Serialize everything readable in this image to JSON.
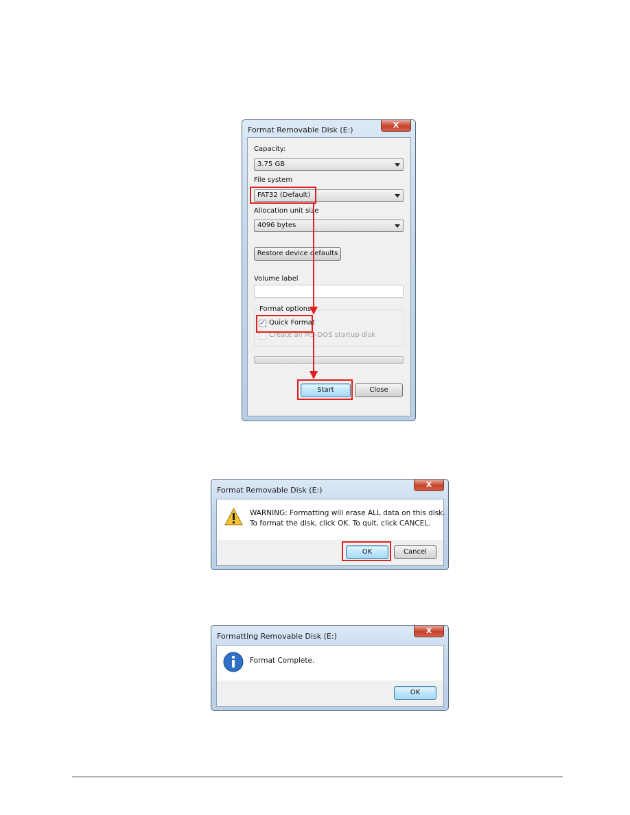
{
  "dialog1": {
    "title": "Format Removable Disk (E:)",
    "close_glyph": "X",
    "capacity_label": "Capacity:",
    "capacity_value": "3.75 GB",
    "file_system_label": "File system",
    "file_system_value": "FAT32 (Default)",
    "allocation_label": "Allocation unit size",
    "allocation_value": "4096 bytes",
    "restore_button": "Restore device defaults",
    "volume_label": "Volume label",
    "volume_value": "",
    "format_options_label": "Format options",
    "quick_format_label": "Quick Format",
    "quick_format_checked": true,
    "msdos_label": "Create an MS-DOS startup disk",
    "msdos_checked": false,
    "progress": 0,
    "start_button": "Start",
    "close_button": "Close"
  },
  "dialog2": {
    "title": "Format Removable Disk (E:)",
    "close_glyph": "X",
    "icon": "warning-icon",
    "message_line1": "WARNING: Formatting will erase ALL data on this disk.",
    "message_line2": "To format the disk, click OK. To quit, click CANCEL.",
    "ok_button": "OK",
    "cancel_button": "Cancel"
  },
  "dialog3": {
    "title": "Formatting Removable Disk (E:)",
    "close_glyph": "X",
    "icon": "info-icon",
    "message": "Format Complete.",
    "ok_button": "OK"
  },
  "colors": {
    "highlight": "#e02020",
    "accent": "#3c7fb1"
  }
}
